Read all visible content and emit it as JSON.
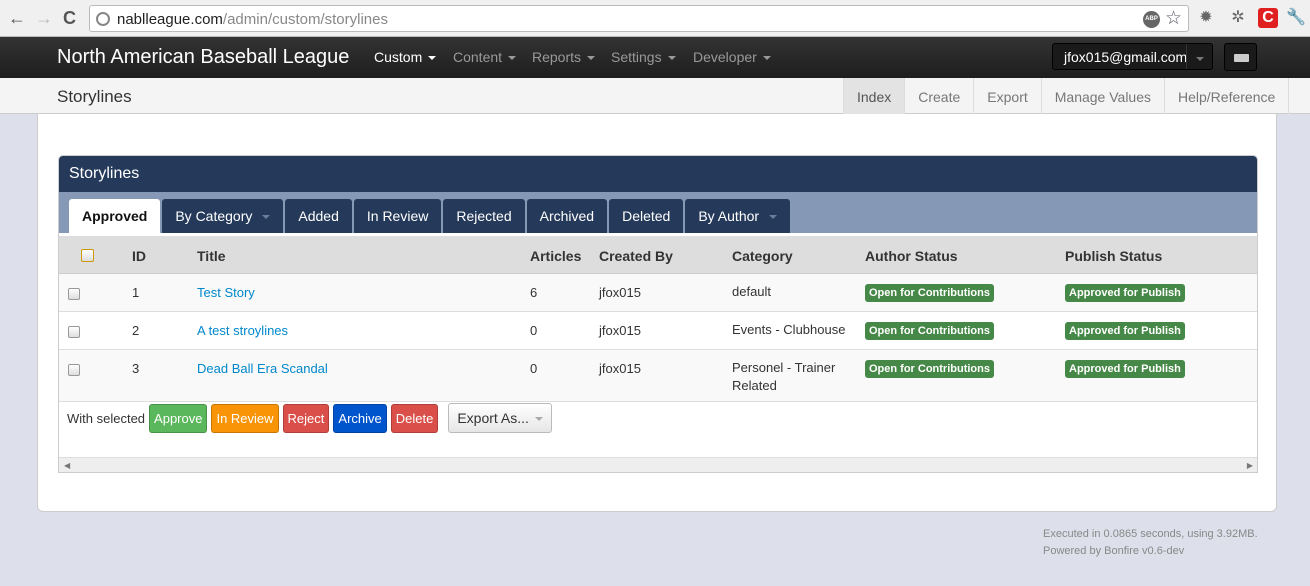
{
  "browser": {
    "url_domain": "nablleague.com",
    "url_path": "/admin/custom/storylines",
    "abp": "ABP"
  },
  "navbar": {
    "brand": "North American Baseball League",
    "menus": [
      "Custom",
      "Content",
      "Reports",
      "Settings",
      "Developer"
    ],
    "user": "jfox015@gmail.com"
  },
  "subnav": {
    "title": "Storylines",
    "tabs": [
      "Index",
      "Create",
      "Export",
      "Manage Values",
      "Help/Reference"
    ]
  },
  "panel": {
    "title": "Storylines",
    "tabs": [
      "Approved",
      "By Category",
      "Added",
      "In Review",
      "Rejected",
      "Archived",
      "Deleted",
      "By Author"
    ]
  },
  "table": {
    "headers": [
      "ID",
      "Title",
      "Articles",
      "Created By",
      "Category",
      "Author Status",
      "Publish Status"
    ],
    "rows": [
      {
        "id": "1",
        "title": "Test Story",
        "articles": "6",
        "created_by": "jfox015",
        "category": "default",
        "author_status": "Open for Contributions",
        "publish_status": "Approved for Publish"
      },
      {
        "id": "2",
        "title": "A test stroylines",
        "articles": "0",
        "created_by": "jfox015",
        "category": "Events - Clubhouse",
        "author_status": "Open for Contributions",
        "publish_status": "Approved for Publish"
      },
      {
        "id": "3",
        "title": "Dead Ball Era Scandal",
        "articles": "0",
        "created_by": "jfox015",
        "category": "Personel - Trainer Related",
        "author_status": "Open for Contributions",
        "publish_status": "Approved for Publish"
      }
    ]
  },
  "actions": {
    "label": "With selected",
    "approve": "Approve",
    "review": "In Review",
    "reject": "Reject",
    "archive": "Archive",
    "delete": "Delete",
    "export": "Export As..."
  },
  "footer": {
    "executed": "Executed in 0.0865 seconds, using 3.92MB.",
    "powered": "Powered by Bonfire v0.6-dev"
  },
  "colors": {
    "navy": "#253a5a",
    "success": "#468847",
    "approve": "#5bb75b",
    "warning": "#f89406",
    "danger": "#da4f49",
    "primary": "#0055cc"
  }
}
